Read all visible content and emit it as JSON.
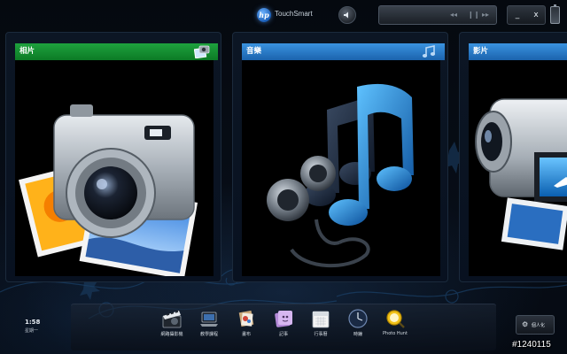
{
  "header": {
    "logo_text": "hp",
    "app_title": "TouchSmart",
    "media": {
      "prev": "◂◂",
      "pause": "❙❙",
      "next": "▸▸"
    },
    "window": {
      "minimize": "_",
      "close": "x"
    }
  },
  "panels": [
    {
      "title": "相片",
      "color": "#0f8a2a"
    },
    {
      "title": "音樂",
      "color": "#1f78c8"
    },
    {
      "title": "影片",
      "color": "#1f78c8"
    }
  ],
  "clock": {
    "time": "1:58",
    "date": "星期一"
  },
  "dock": {
    "items": [
      {
        "label": "網路攝影機",
        "icon": "webcam-clapper-icon"
      },
      {
        "label": "教學課程",
        "icon": "tutorial-laptop-icon"
      },
      {
        "label": "畫布",
        "icon": "canvas-icon"
      },
      {
        "label": "記事",
        "icon": "notes-icon"
      },
      {
        "label": "行事曆",
        "icon": "calendar-icon"
      },
      {
        "label": "時鐘",
        "icon": "clock-icon"
      },
      {
        "label": "Photo Hunt",
        "icon": "photo-hunt-icon"
      }
    ]
  },
  "personalize": {
    "label": "個人化"
  },
  "watermark": "#1240115"
}
